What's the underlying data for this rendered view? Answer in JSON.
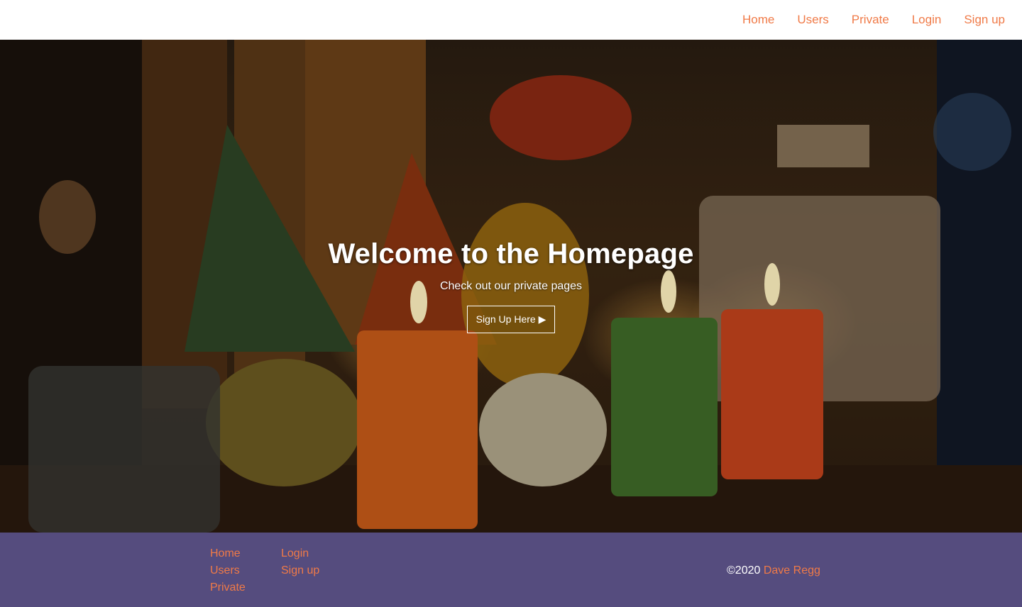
{
  "colors": {
    "accent": "#f07a47",
    "footer_bg": "#554c7e",
    "header_bg": "#ffffff"
  },
  "nav": {
    "items": [
      {
        "label": "Home"
      },
      {
        "label": "Users"
      },
      {
        "label": "Private"
      },
      {
        "label": "Login"
      },
      {
        "label": "Sign up"
      }
    ]
  },
  "hero": {
    "title": "Welcome to the Homepage",
    "subtitle": "Check out our private pages",
    "button_label": "Sign Up Here",
    "button_icon": "▶"
  },
  "footer": {
    "col1": [
      {
        "label": "Home"
      },
      {
        "label": "Users"
      },
      {
        "label": "Private"
      }
    ],
    "col2": [
      {
        "label": "Login"
      },
      {
        "label": "Sign up"
      }
    ],
    "copyright_prefix": "©2020",
    "author": "Dave Regg"
  }
}
